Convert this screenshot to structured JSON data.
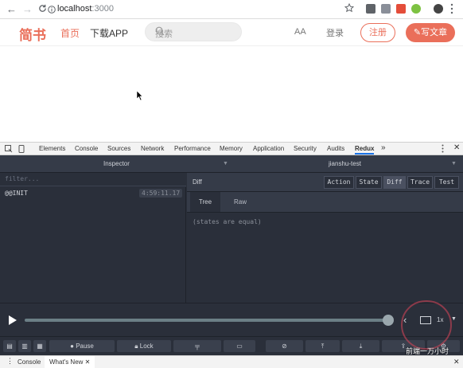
{
  "browser": {
    "url_host": "localhost",
    "url_port": ":3000",
    "nav_back": "←",
    "nav_forward": "→",
    "nav_reload": "C"
  },
  "site": {
    "logo": "简书",
    "nav_home": "首页",
    "nav_app": "下载APP",
    "search_placeholder": "搜索",
    "font_toggle": "AA",
    "login": "登录",
    "register": "注册",
    "write": "写文章",
    "brand_color": "#ea6f5a"
  },
  "devtools": {
    "tabs": [
      "Elements",
      "Console",
      "Sources",
      "Network",
      "Performance",
      "Memory",
      "Application",
      "Security",
      "Audits",
      "Redux"
    ],
    "more": "»",
    "drawer_tabs": [
      "Console",
      "What's New"
    ]
  },
  "redux": {
    "inspector_label": "Inspector",
    "instance_label": "jianshu-test",
    "filter_placeholder": "filter...",
    "actions": [
      {
        "name": "@@INIT",
        "time": "4:59:11.17"
      }
    ],
    "monitor_title": "Diff",
    "monitor_tabs": [
      "Action",
      "State",
      "Diff",
      "Trace",
      "Test"
    ],
    "active_monitor_tab": "Diff",
    "sub_tabs": [
      "Tree",
      "Raw"
    ],
    "active_sub_tab": "Tree",
    "diff_message": "(states are equal)",
    "speed": "1x",
    "bottom_buttons": [
      "Pause",
      "Lock"
    ]
  },
  "watermark": "前端一万小时"
}
